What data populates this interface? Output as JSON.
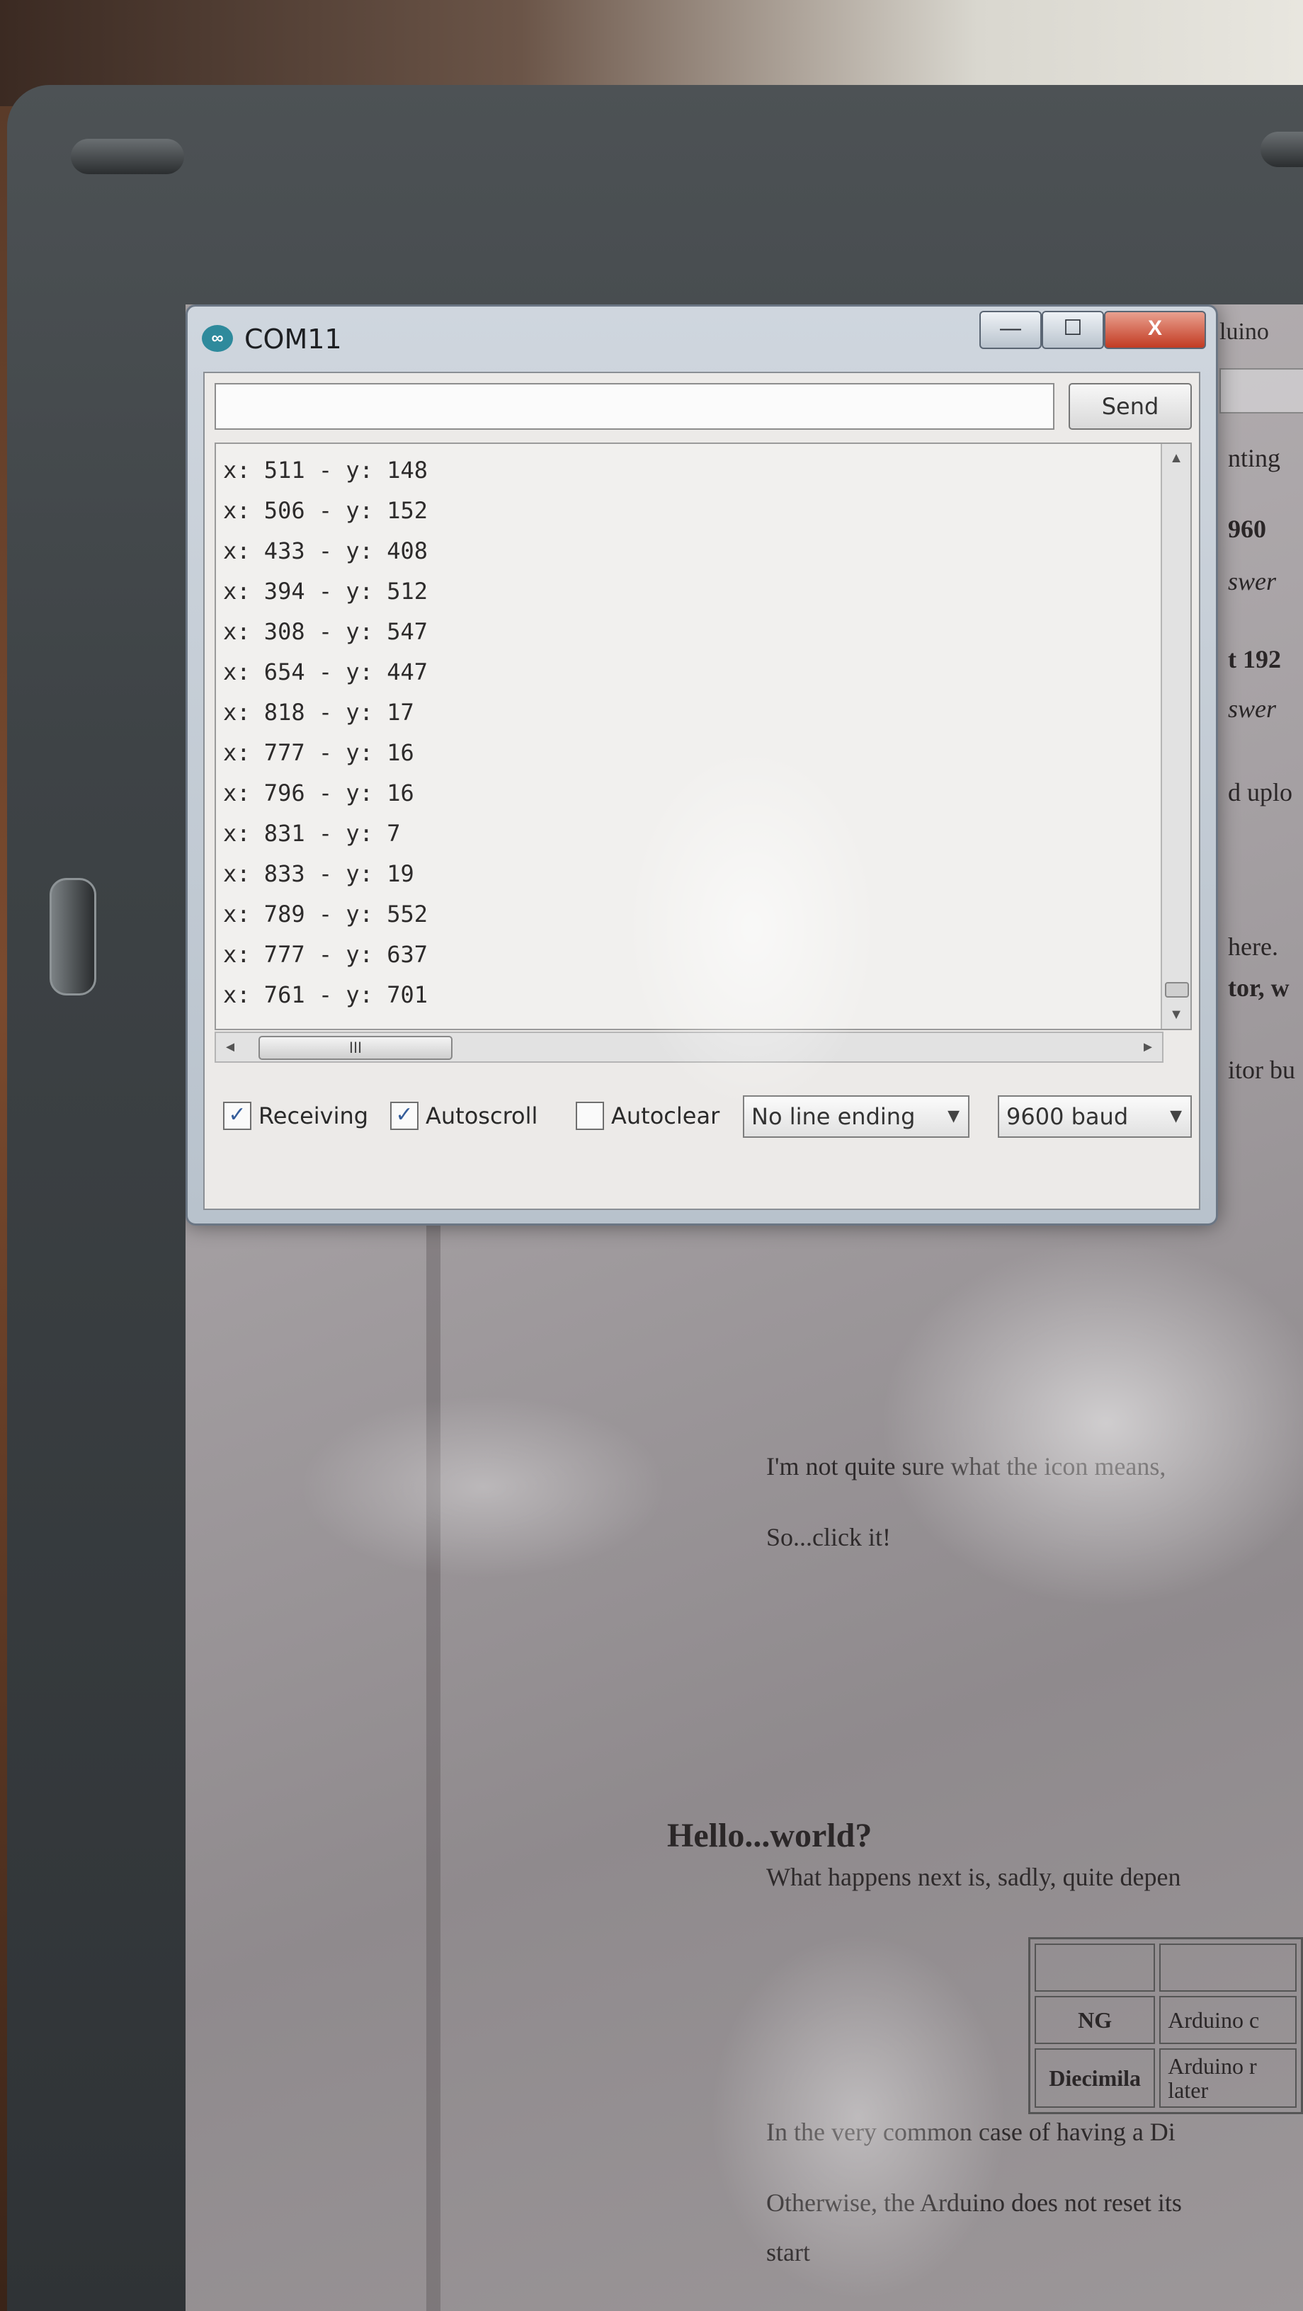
{
  "window": {
    "title": "COM11",
    "app_icon": "∞",
    "controls": {
      "minimize": "—",
      "maximize": "☐",
      "close": "X"
    }
  },
  "input": {
    "value": "",
    "placeholder": ""
  },
  "send_label": "Send",
  "serial_output": [
    "x: 511 - y: 148",
    "x: 506 - y: 152",
    "x: 433 - y: 408",
    "x: 394 - y: 512",
    "x: 308 - y: 547",
    "x: 654 - y: 447",
    "x: 818 - y: 17",
    "x: 777 - y: 16",
    "x: 796 - y: 16",
    "x: 831 - y: 7",
    "x: 833 - y: 19",
    "x: 789 - y: 552",
    "x: 777 - y: 637",
    "x: 761 - y: 701"
  ],
  "scroll": {
    "up": "▲",
    "down": "▼",
    "left": "◄",
    "right": "►",
    "hthumb": "III"
  },
  "options": {
    "receiving": {
      "label": "Receiving",
      "checked": true
    },
    "autoscroll": {
      "label": "Autoscroll",
      "checked": true
    },
    "autoclear": {
      "label": "Autoclear",
      "checked": false
    },
    "check_glyph": "✓",
    "line_ending": "No line ending",
    "baud": "9600 baud"
  },
  "background_page": {
    "tab_fragment": "luino",
    "toolbar_button": "Send",
    "side_fragments": [
      "nting",
      "960",
      "swer",
      "t 192",
      "swer",
      "d uplo",
      "here.",
      "tor, w",
      "itor bu"
    ],
    "paragraphs": [
      "I'm not quite sure what the icon means,",
      "So...click it!"
    ],
    "heading": "Hello...world?",
    "intro": "What happens next is, sadly, quite depen",
    "table": [
      {
        "head": "",
        "cell": ""
      },
      {
        "head": "NG",
        "cell": "Arduino c"
      },
      {
        "head": "Diecimila",
        "cell": "Arduino r later"
      }
    ],
    "after_table_1": "In the very common case of having a Di",
    "after_table_2": "Otherwise, the Arduino does not reset its",
    "after_table_3": "start"
  }
}
